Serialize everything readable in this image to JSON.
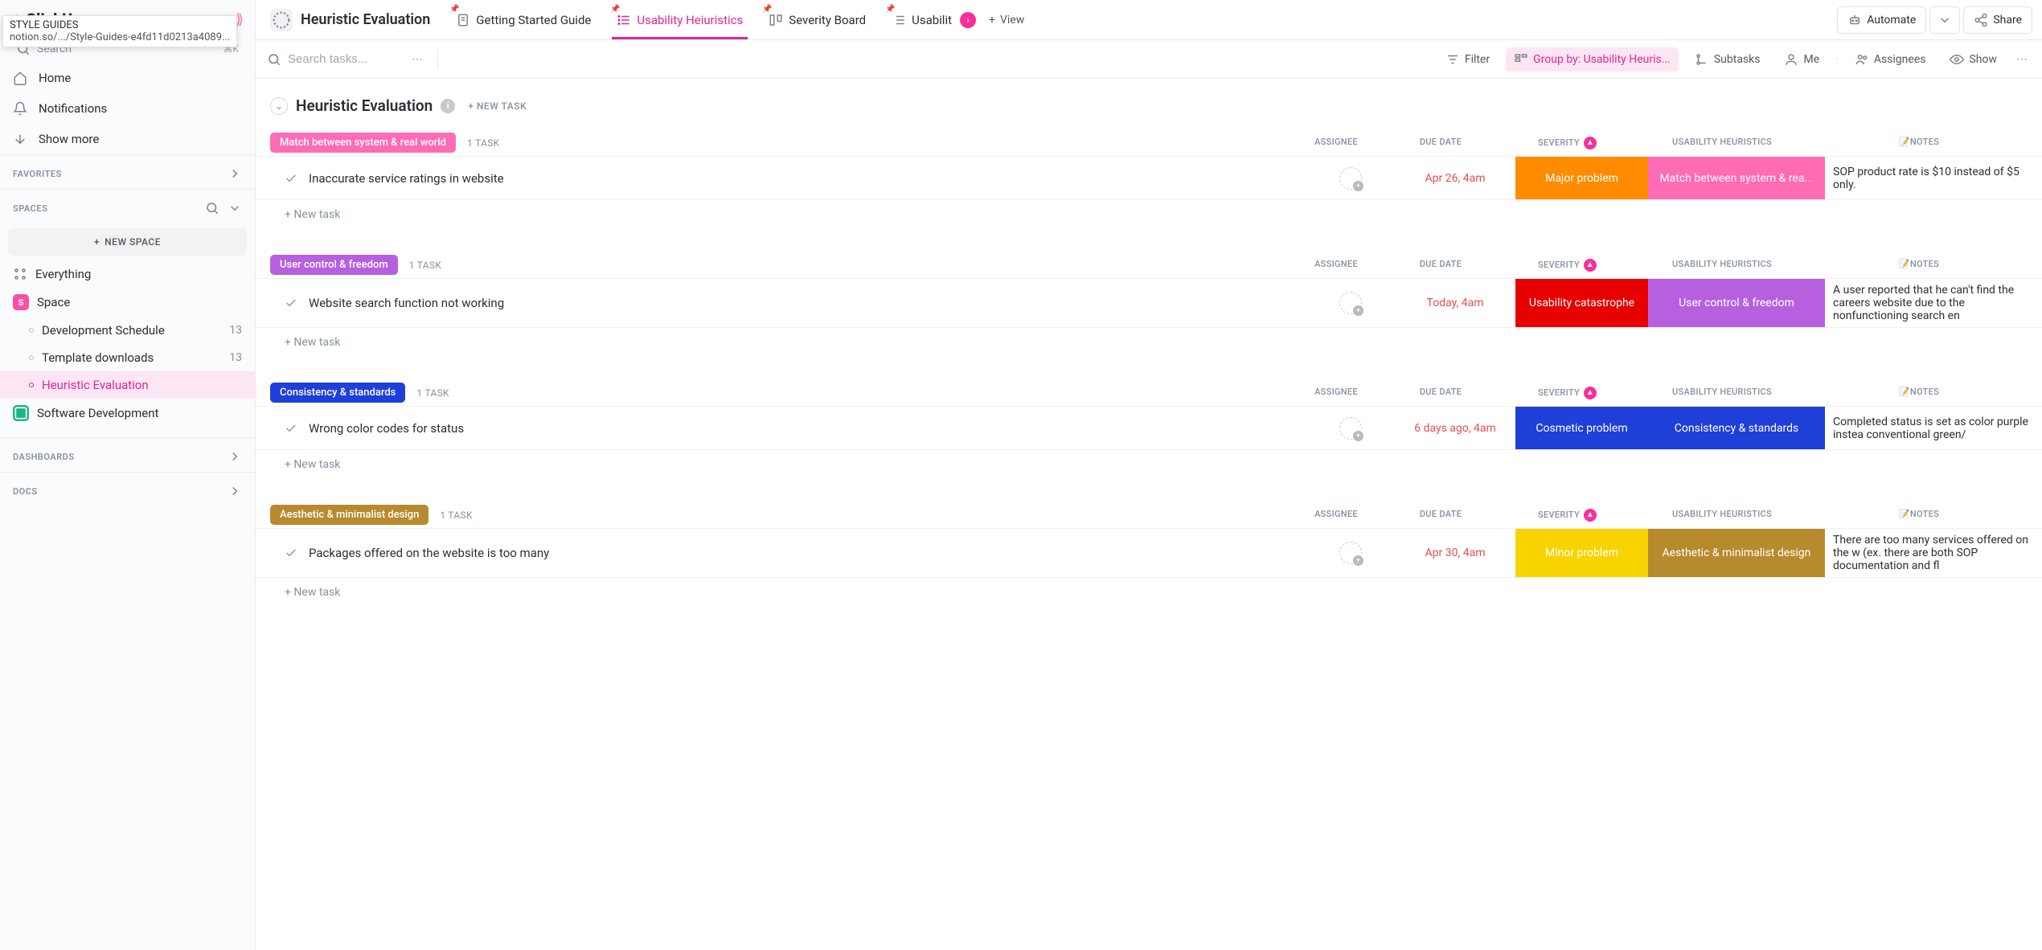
{
  "tooltip": {
    "title": "STYLE GUIDES",
    "url": "notion.so/.../Style-Guides-e4fd11d0213a4089..."
  },
  "logo": "ClickUp",
  "search": {
    "placeholder": "Search",
    "shortcut": "⌘K"
  },
  "nav": {
    "home": "Home",
    "notifications": "Notifications",
    "showmore": "Show more"
  },
  "sections": {
    "favorites": "FAVORITES",
    "spaces": "SPACES",
    "dashboards": "DASHBOARDS",
    "docs": "DOCS"
  },
  "newspace": "NEW SPACE",
  "tree": {
    "everything": "Everything",
    "space": {
      "label": "Space",
      "badge": "S"
    },
    "items": [
      {
        "label": "Development Schedule",
        "count": "13"
      },
      {
        "label": "Template downloads",
        "count": "13"
      },
      {
        "label": "Heuristic Evaluation",
        "count": ""
      }
    ],
    "softdev": "Software Development"
  },
  "breadcrumb": "Heuristic Evaluation",
  "tabs": [
    {
      "label": "Getting Started Guide"
    },
    {
      "label": "Usability Heiuristics"
    },
    {
      "label": "Severity Board"
    },
    {
      "label": "Usabilit"
    }
  ],
  "addview": "View",
  "toolbar": {
    "automate": "Automate",
    "share": "Share"
  },
  "filterbar": {
    "search_placeholder": "Search tasks...",
    "filter": "Filter",
    "groupby": "Group by: Usability Heuris...",
    "subtasks": "Subtasks",
    "me": "Me",
    "assignees": "Assignees",
    "show": "Show"
  },
  "page": {
    "title": "Heuristic Evaluation",
    "newtask": "+ NEW TASK",
    "addtask": "+ New task"
  },
  "columns": {
    "assignee": "ASSIGNEE",
    "due": "DUE DATE",
    "sev": "SEVERITY",
    "heur": "USABILITY HEURISTICS",
    "notes": "📝NOTES"
  },
  "groups": [
    {
      "name": "Match between system & real world",
      "color": "#ff6bb5",
      "count": "1 TASK",
      "tasks": [
        {
          "title": "Inaccurate service ratings in website",
          "due": "Apr 26, 4am",
          "sev": "Major problem",
          "sev_bg": "#ff8b00",
          "heur": "Match between system & rea...",
          "heur_bg": "#ff6bb5",
          "notes": "SOP product rate is $10 instead of $5 only."
        }
      ]
    },
    {
      "name": "User control & freedom",
      "color": "#b660e0",
      "count": "1 TASK",
      "tasks": [
        {
          "title": "Website search function not working",
          "due": "Today, 4am",
          "sev": "Usability catastrophe",
          "sev_bg": "#e60000",
          "heur": "User control & freedom",
          "heur_bg": "#b660e0",
          "notes": "A user reported that he can't find the careers website due to the nonfunctioning search en"
        }
      ]
    },
    {
      "name": "Consistency & standards",
      "color": "#1f3fd9",
      "count": "1 TASK",
      "tasks": [
        {
          "title": "Wrong color codes for status",
          "due": "6 days ago, 4am",
          "sev": "Cosmetic problem",
          "sev_bg": "#1f3fd9",
          "heur": "Consistency & standards",
          "heur_bg": "#1f3fd9",
          "notes": "Completed status is set as color purple instea conventional green/"
        }
      ]
    },
    {
      "name": "Aesthetic & minimalist design",
      "color": "#b88a2e",
      "count": "1 TASK",
      "tasks": [
        {
          "title": "Packages offered on the website is too many",
          "due": "Apr 30, 4am",
          "sev": "Minor problem",
          "sev_bg": "#f7d400",
          "heur": "Aesthetic & minimalist design",
          "heur_bg": "#b88a2e",
          "notes": "There are too many services offered on the w (ex. there are both SOP documentation and fl"
        }
      ]
    }
  ]
}
